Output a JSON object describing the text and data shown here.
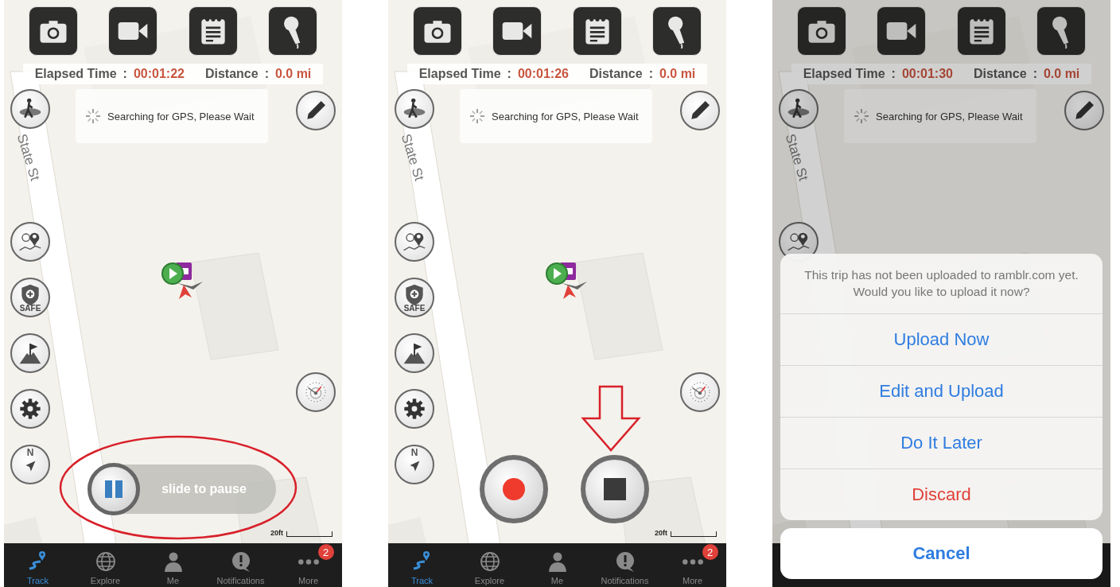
{
  "panels": [
    {
      "stats": [
        {
          "label": "Elapsed Time",
          "separator": ":",
          "value": "00:01:22"
        },
        {
          "label": "Distance",
          "separator": ":",
          "value": "0.0 mi"
        }
      ],
      "gps_status": "Searching for GPS, Please Wait",
      "street": "State St",
      "left_buttons": [
        {
          "kind": "hiker"
        },
        {
          "kind": "people_map"
        },
        {
          "kind": "safety",
          "label": "SAFE"
        },
        {
          "kind": "summit_flag"
        },
        {
          "kind": "settings"
        },
        {
          "kind": "compass",
          "label": "N"
        }
      ],
      "right_buttons": [
        {
          "kind": "pencil"
        },
        {
          "kind": "speedometer"
        }
      ],
      "marker": true,
      "control": {
        "kind": "slider",
        "label": "slide to pause"
      },
      "annotation": {
        "kind": "ellipse"
      },
      "scale": "20ft",
      "tabs": [
        {
          "label": "Track",
          "selected": true
        },
        {
          "label": "Explore",
          "selected": false
        },
        {
          "label": "Me",
          "selected": false
        },
        {
          "label": "Notifications",
          "selected": false
        },
        {
          "label": "More",
          "selected": false,
          "badge": "2"
        }
      ],
      "dimmed": false
    },
    {
      "stats": [
        {
          "label": "Elapsed Time",
          "separator": ":",
          "value": "00:01:26"
        },
        {
          "label": "Distance",
          "separator": ":",
          "value": "0.0 mi"
        }
      ],
      "gps_status": "Searching for GPS, Please Wait",
      "street": "State St",
      "left_buttons": [
        {
          "kind": "hiker"
        },
        {
          "kind": "people_map"
        },
        {
          "kind": "safety",
          "label": "SAFE"
        },
        {
          "kind": "summit_flag"
        },
        {
          "kind": "settings"
        },
        {
          "kind": "compass",
          "label": "N"
        }
      ],
      "right_buttons": [
        {
          "kind": "pencil"
        },
        {
          "kind": "speedometer"
        }
      ],
      "marker": true,
      "control": {
        "kind": "record_stop"
      },
      "annotation": {
        "kind": "arrow"
      },
      "scale": "20ft",
      "tabs": [
        {
          "label": "Track",
          "selected": true
        },
        {
          "label": "Explore",
          "selected": false
        },
        {
          "label": "Me",
          "selected": false
        },
        {
          "label": "Notifications",
          "selected": false
        },
        {
          "label": "More",
          "selected": false,
          "badge": "2"
        }
      ],
      "dimmed": false
    },
    {
      "stats": [
        {
          "label": "Elapsed Time",
          "separator": ":",
          "value": "00:01:30"
        },
        {
          "label": "Distance",
          "separator": ":",
          "value": "0.0 mi"
        }
      ],
      "gps_status": "Searching for GPS, Please Wait",
      "street": "State St",
      "left_buttons": [
        {
          "kind": "hiker"
        },
        {
          "kind": "people_map"
        }
      ],
      "right_buttons": [
        {
          "kind": "pencil"
        }
      ],
      "dimmed": true,
      "action_sheet": {
        "message": "This trip has not been uploaded to ramblr.com yet. Would you like to upload it now?",
        "actions": [
          {
            "label": "Upload Now",
            "kind": "default"
          },
          {
            "label": "Edit and Upload",
            "kind": "default"
          },
          {
            "label": "Do It Later",
            "kind": "default"
          },
          {
            "label": "Discard",
            "kind": "destructive"
          }
        ],
        "cancel": "Cancel"
      }
    }
  ]
}
